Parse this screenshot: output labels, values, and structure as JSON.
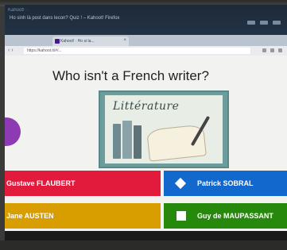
{
  "browser": {
    "window_title": "Kahoot! ·",
    "window_subtitle": "Ho sinh là post dans lecon? Quiz ! – Kahoot! Firefox",
    "tab_label": "Kahoot! · Ho si la...",
    "address": "https://kahoot.it/#/..."
  },
  "quiz": {
    "question": "Who isn't a French writer?",
    "image_word": "Littérature",
    "answers": [
      {
        "label": "Gustave FLAUBERT",
        "color": "#e21b3c",
        "shape": "triangle"
      },
      {
        "label": "Patrick SOBRAL",
        "color": "#1368ce",
        "shape": "diamond"
      },
      {
        "label": "Jane AUSTEN",
        "color": "#d89e00",
        "shape": "circle"
      },
      {
        "label": "Guy de MAUPASSANT",
        "color": "#26890c",
        "shape": "square"
      }
    ]
  },
  "colors": {
    "accent_purple": "#8c3bb3"
  }
}
